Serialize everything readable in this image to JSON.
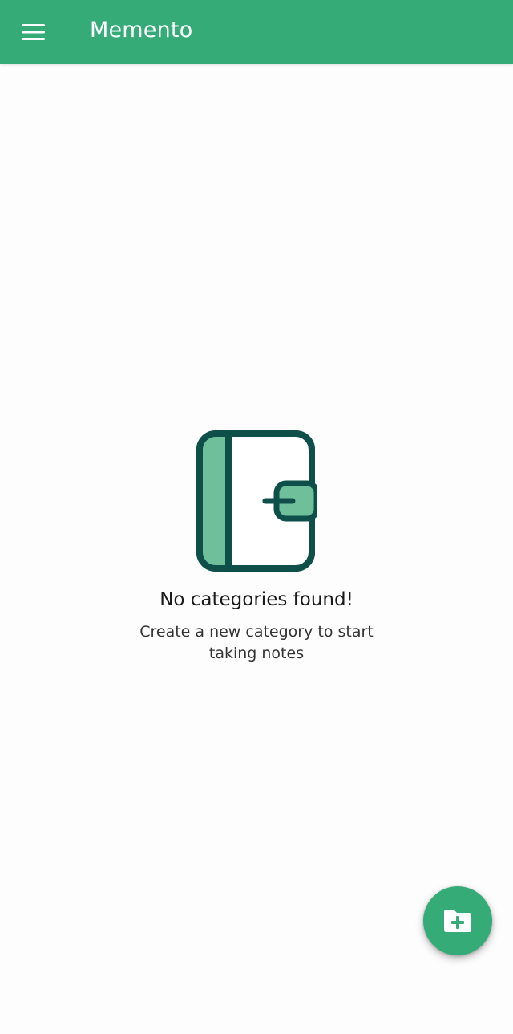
{
  "app_bar": {
    "title": "Memento",
    "menu_icon": "hamburger-menu-icon",
    "background_color": "#35ac77"
  },
  "empty_state": {
    "illustration_icon": "notebook-icon",
    "title": "No categories found!",
    "subtitle": "Create a new category to start taking notes",
    "icon_outline_color": "#0f4f4a",
    "icon_fill_color": "#6fbf9b"
  },
  "fab": {
    "icon": "new-folder-plus-icon",
    "background_color": "#35ac77"
  }
}
